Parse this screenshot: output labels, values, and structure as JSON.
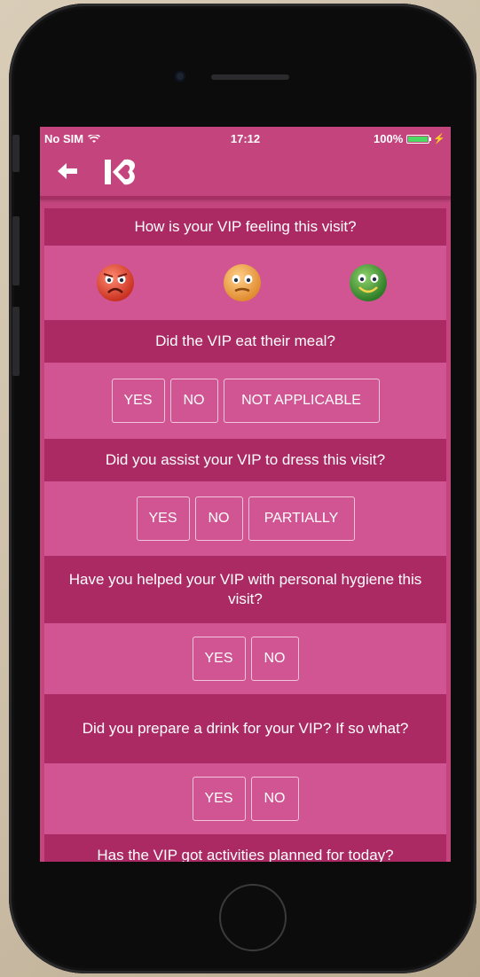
{
  "status": {
    "carrier": "No SIM",
    "time": "17:12",
    "battery": "100%"
  },
  "nav": {
    "back_icon": "arrow-left-icon",
    "logo_icon": "brand-logo-icon"
  },
  "questions": [
    {
      "text": "How is your VIP feeling this visit?",
      "type": "mood",
      "options": [
        "sad-face-icon",
        "neutral-face-icon",
        "happy-face-icon"
      ]
    },
    {
      "text": "Did the VIP eat their meal?",
      "options": [
        "YES",
        "NO",
        "NOT APPLICABLE"
      ]
    },
    {
      "text": "Did you assist your VIP to dress this visit?",
      "options": [
        "YES",
        "NO",
        "PARTIALLY"
      ]
    },
    {
      "text": "Have you helped your VIP with personal hygiene this visit?",
      "options": [
        "YES",
        "NO"
      ]
    },
    {
      "text": "Did you prepare a drink for your VIP? If so what?",
      "options": [
        "YES",
        "NO"
      ]
    },
    {
      "text": "Has the VIP got activities planned for today?"
    }
  ],
  "colors": {
    "screen_bg": "#c4457e",
    "question_bg": "#ab2a64",
    "answer_bg": "#d05592",
    "sad": "#e0463a",
    "neutral": "#f0a24a",
    "happy": "#3f9a3a"
  }
}
